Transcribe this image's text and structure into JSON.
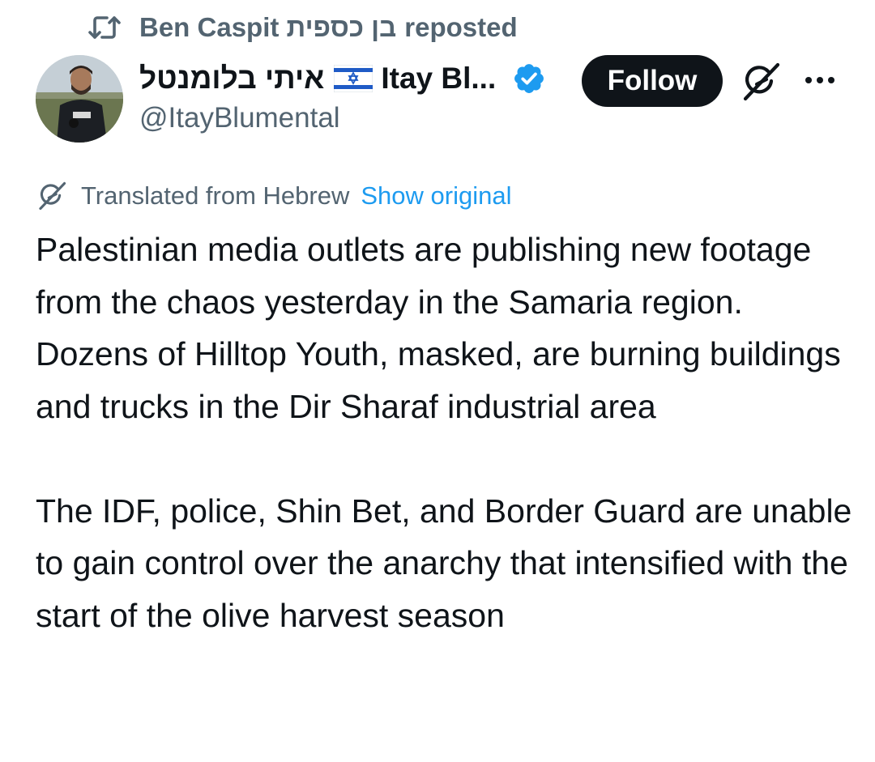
{
  "repost": {
    "icon": "repost-icon",
    "reposter_name": "Ben Caspit בן כספית",
    "label": "reposted"
  },
  "author": {
    "avatar": "avatar",
    "name_hebrew": "איתי בלומנטל",
    "flag": "israel-flag-icon",
    "name_latin": "Itay Bl...",
    "verified_icon": "verified-badge-icon",
    "verified_color": "#1d9bf0",
    "handle": "@ItayBlumental"
  },
  "actions": {
    "follow_label": "Follow",
    "grok_icon": "grok-icon",
    "more_icon": "more-options-icon"
  },
  "translation": {
    "icon": "grok-icon",
    "text": "Translated from Hebrew",
    "show_original_label": "Show original",
    "link_color": "#1d9bf0"
  },
  "tweet": {
    "paragraphs": [
      "Palestinian media outlets are publishing new footage from the chaos yesterday in the Samaria region. Dozens of Hilltop Youth, masked, are burning buildings and trucks in the Dir Sharaf industrial area",
      "The IDF, police, Shin Bet, and Border Guard are unable to gain control over the anarchy that intensified with the start of the olive harvest season"
    ]
  }
}
